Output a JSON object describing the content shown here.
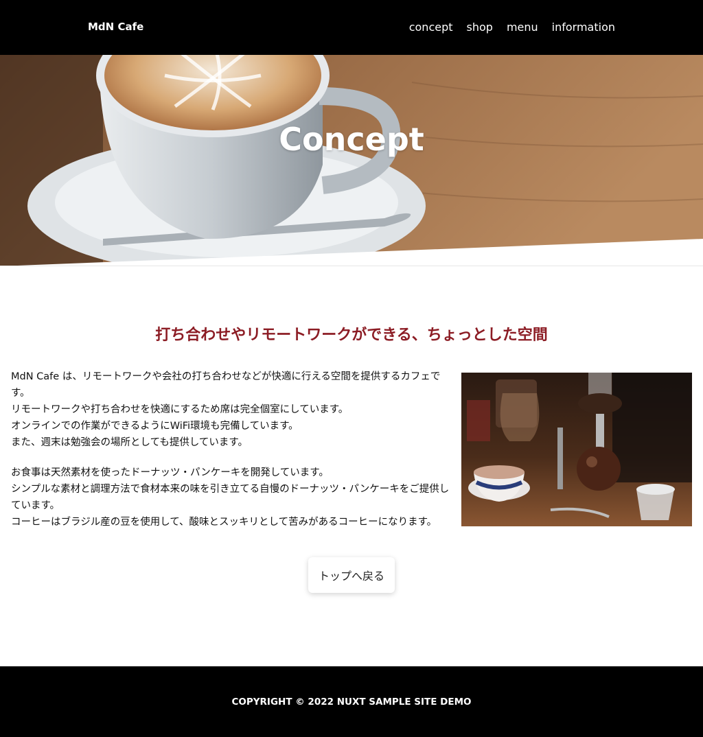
{
  "header": {
    "brand": "MdN Cafe",
    "nav": [
      "concept",
      "shop",
      "menu",
      "information"
    ]
  },
  "hero": {
    "title": "Concept"
  },
  "main": {
    "heading": "打ち合わせやリモートワークができる、ちょっとした空間",
    "paragraphs": [
      [
        "MdN Cafe は、リモートワークや会社の打ち合わせなどが快適に行える空間を提供するカフェです。",
        "リモートワークや打ち合わせを快適にするため席は完全個室にしています。",
        "オンラインでの作業ができるようにWiFi環境も完備しています。",
        "また、週末は勉強会の場所としても提供しています。"
      ],
      [
        "お食事は天然素材を使ったドーナッツ・パンケーキを開発しています。",
        "シンプルな素材と調理方法で食材本来の味を引き立てる自慢のドーナッツ・パンケーキをご提供しています。",
        "コーヒーはブラジル産の豆を使用して、酸味とスッキリとして苦みがあるコーヒーになります。"
      ]
    ],
    "back_button": "トップへ戻る"
  },
  "footer": {
    "copyright": "COPYRIGHT © 2022 NUXT SAMPLE SITE DEMO"
  },
  "colors": {
    "header_bg": "#000000",
    "heading": "#8c1c24",
    "footer_bg": "#000000"
  }
}
